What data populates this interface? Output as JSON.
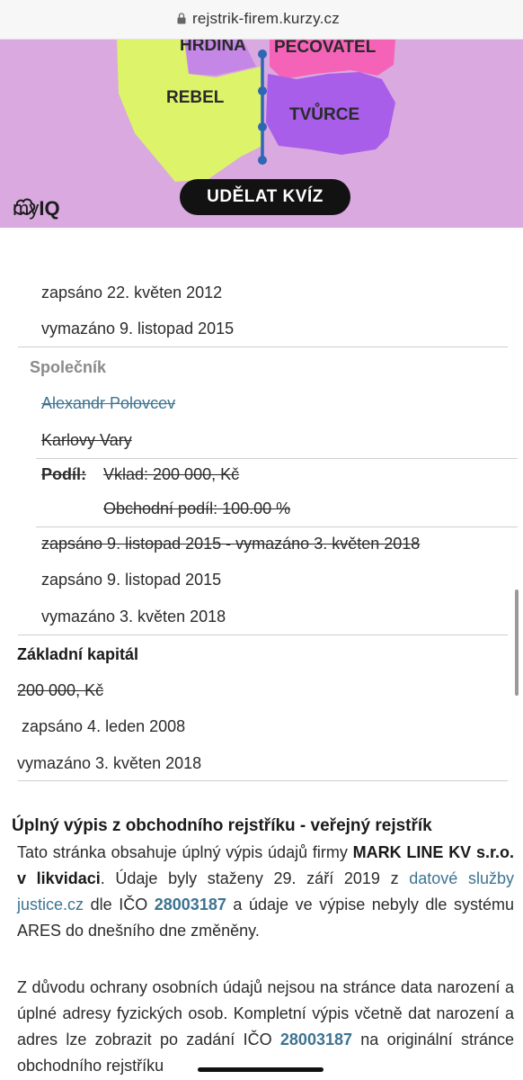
{
  "browser": {
    "url": "rejstrik-firem.kurzy.cz"
  },
  "ad": {
    "labels": [
      "HRDINA",
      "PEČOVATEL",
      "REBEL",
      "TVŮRCE"
    ],
    "button_label": "UDĚLAT KVÍZ",
    "brand_prefix": "my",
    "brand_suffix": "IQ",
    "colors": {
      "background": "#d9a9df",
      "yellow": "#dcf36a",
      "pink": "#f563b8",
      "purple": "#a85ee8",
      "lilac": "#c587e6",
      "axis": "#2f66b6"
    }
  },
  "entries": {
    "prev_zapsano": "zapsáno 22. květen 2012",
    "prev_vymazano": "vymazáno 9. listopad 2015",
    "spolecnik_label": "Společník",
    "name": "Alexandr Polovcev",
    "city": "Karlovy Vary",
    "podil_label": "Podíl:",
    "vklad": "Vklad: 200 000, Kč",
    "obchodni_podil": "Obchodní podíl: 100.00 %",
    "range": "zapsáno 9. listopad 2015 - vymazáno 3. květen 2018",
    "zapsano": "zapsáno 9. listopad 2015",
    "vymazano": "vymazáno 3. květen 2018",
    "kapital_label": "Základní kapitál",
    "kapital_value": "200 000, Kč",
    "kapital_zapsano": "zapsáno 4. leden 2008",
    "kapital_vymazano": "vymazáno 3. květen 2018"
  },
  "info": {
    "heading": "Úplný výpis z obchodního rejstříku - veřejný rejstřík",
    "p1_a": "Tato stránka obsahuje úplný výpis údajů firmy ",
    "company": "MARK LINE KV s.r.o. v likvidaci",
    "p1_b": ". Údaje byly staženy 29. září 2019 z ",
    "source_link": "datové služby justice.cz",
    "p1_c": " dle IČO ",
    "ico": "28003187",
    "p1_d": " a údaje ve výpise nebyly dle systému ARES do dnešního dne změněny.",
    "p2_a": "Z důvodu ochrany osobních údajů nejsou na stránce data narození a úplné adresy fyzických osob. Kompletní výpis včetně dat narození a adres lze zobrazit po zadání IČO ",
    "p2_b": " na originální stránce obchodního rejstříku"
  }
}
